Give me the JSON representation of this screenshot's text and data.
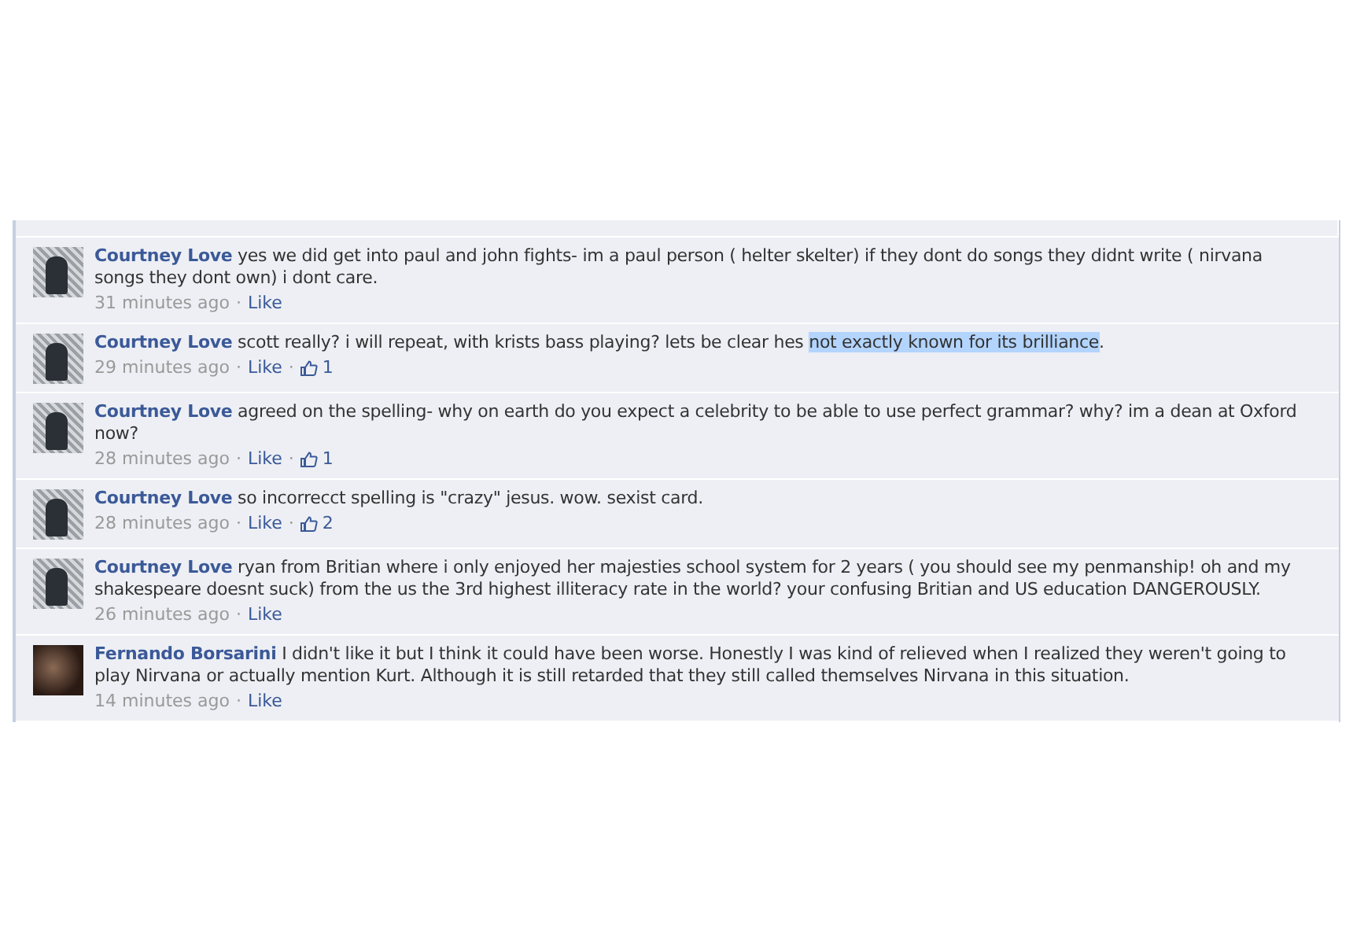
{
  "comments": [
    {
      "author": "Courtney Love",
      "kind": "light",
      "segments": [
        {
          "text": "yes we did get into paul and john fights- im a paul person ( helter skelter) if they dont do songs they didnt write ( nirvana songs they dont own) i dont care.",
          "highlighted": false
        }
      ],
      "meta": [
        {
          "kind": "time",
          "text": "31 minutes ago"
        },
        {
          "kind": "sep",
          "text": "·"
        },
        {
          "kind": "like",
          "text": "Like"
        }
      ]
    },
    {
      "author": "Courtney Love",
      "kind": "light",
      "segments": [
        {
          "text": "scott really? i will repeat, with krists bass playing? lets be clear hes ",
          "highlighted": false
        },
        {
          "text": "not exactly known for its brilliance",
          "highlighted": true
        },
        {
          "text": ".",
          "highlighted": false
        }
      ],
      "meta": [
        {
          "kind": "time",
          "text": "29 minutes ago"
        },
        {
          "kind": "sep",
          "text": "·"
        },
        {
          "kind": "like",
          "text": "Like"
        },
        {
          "kind": "sep",
          "text": "·"
        },
        {
          "kind": "likes",
          "text": "1"
        }
      ]
    },
    {
      "author": "Courtney Love",
      "kind": "light",
      "segments": [
        {
          "text": "agreed on the spelling- why on earth do you expect a celebrity to be able to use perfect grammar? why? im a dean at Oxford now?",
          "highlighted": false
        }
      ],
      "meta": [
        {
          "kind": "time",
          "text": "28 minutes ago"
        },
        {
          "kind": "sep",
          "text": "·"
        },
        {
          "kind": "like",
          "text": "Like"
        },
        {
          "kind": "sep",
          "text": "·"
        },
        {
          "kind": "likes",
          "text": "1"
        }
      ]
    },
    {
      "author": "Courtney Love",
      "kind": "light",
      "segments": [
        {
          "text": "so incorrecct spelling is \"crazy\" jesus. wow. sexist card.",
          "highlighted": false
        }
      ],
      "meta": [
        {
          "kind": "time",
          "text": "28 minutes ago"
        },
        {
          "kind": "sep",
          "text": "·"
        },
        {
          "kind": "like",
          "text": "Like"
        },
        {
          "kind": "sep",
          "text": "·"
        },
        {
          "kind": "likes",
          "text": "2"
        }
      ]
    },
    {
      "author": "Courtney Love",
      "kind": "light",
      "segments": [
        {
          "text": "ryan from Britian where i only enjoyed her majesties school system for 2 years ( you should see my penmanship! oh and my shakespeare doesnt suck) from the us the 3rd highest illiteracy rate in the world? your confusing Britian and US education DANGEROUSLY.",
          "highlighted": false
        }
      ],
      "meta": [
        {
          "kind": "time",
          "text": "26 minutes ago"
        },
        {
          "kind": "sep",
          "text": "·"
        },
        {
          "kind": "like",
          "text": "Like"
        }
      ]
    },
    {
      "author": "Fernando Borsarini",
      "kind": "dark",
      "segments": [
        {
          "text": "I didn't like it but I think it could have been worse. Honestly I was kind of relieved when I realized they weren't going to play Nirvana or actually mention Kurt. Although it is still retarded that they still called themselves Nirvana in this situation.",
          "highlighted": false
        }
      ],
      "meta": [
        {
          "kind": "time",
          "text": "14 minutes ago"
        },
        {
          "kind": "sep",
          "text": "·"
        },
        {
          "kind": "like",
          "text": "Like"
        }
      ]
    }
  ]
}
